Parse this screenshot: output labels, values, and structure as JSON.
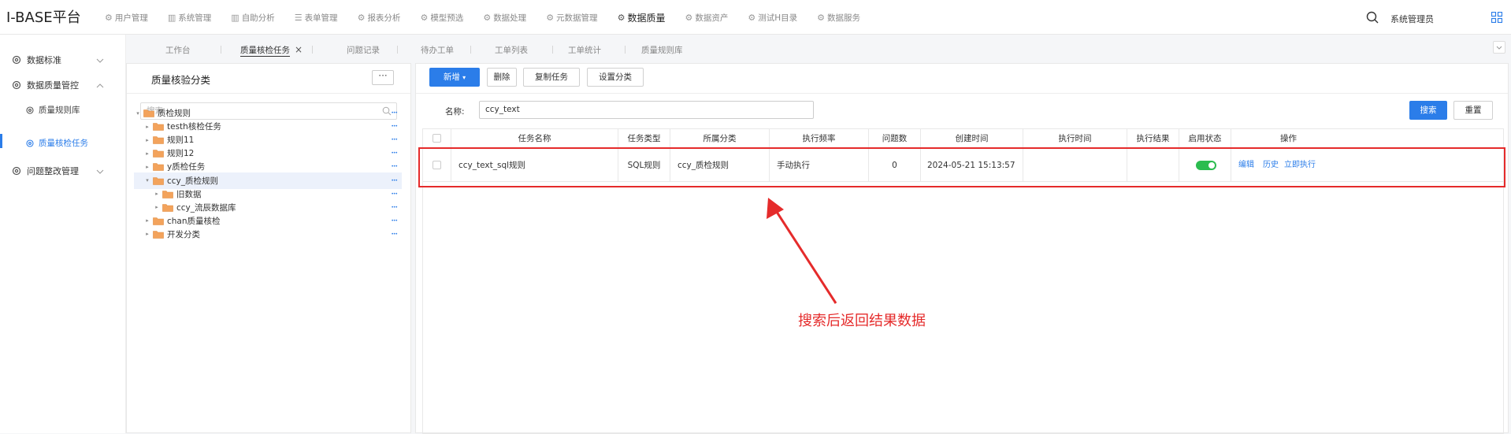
{
  "app": {
    "title": "I-BASE平台"
  },
  "topnav": [
    {
      "label": "用户管理",
      "icon": "gear-icon"
    },
    {
      "label": "系统管理",
      "icon": "bar-chart-icon"
    },
    {
      "label": "自助分析",
      "icon": "bar-chart-icon"
    },
    {
      "label": "表单管理",
      "icon": "list-icon"
    },
    {
      "label": "报表分析",
      "icon": "gear-icon"
    },
    {
      "label": "模型预选",
      "icon": "gear-icon"
    },
    {
      "label": "数据处理",
      "icon": "gear-icon"
    },
    {
      "label": "元数据管理",
      "icon": "gear-icon"
    },
    {
      "label": "数据质量",
      "icon": "gear-icon",
      "active": true
    },
    {
      "label": "数据资产",
      "icon": "gear-icon"
    },
    {
      "label": "测试H目录",
      "icon": "gear-icon"
    },
    {
      "label": "数据服务",
      "icon": "gear-icon"
    }
  ],
  "user": {
    "name": "系统管理员"
  },
  "sidebar": {
    "groups": [
      {
        "label": "数据标准"
      },
      {
        "label": "数据质量管控"
      },
      {
        "label": "问题整改管理"
      }
    ],
    "subitems": [
      {
        "label": "质量规则库"
      },
      {
        "label": "质量核检任务"
      }
    ]
  },
  "tabs": [
    {
      "label": "工作台"
    },
    {
      "label": "质量核检任务",
      "active": true
    },
    {
      "label": "问题记录"
    },
    {
      "label": "待办工单"
    },
    {
      "label": "工单列表"
    },
    {
      "label": "工单统计"
    },
    {
      "label": "质量规则库"
    }
  ],
  "tree": {
    "title": "质量核验分类",
    "more": "···",
    "search_placeholder": "搜索",
    "nodes": [
      {
        "label": "质检规则",
        "level": 0,
        "arrow": "▾"
      },
      {
        "label": "testh核检任务",
        "level": 1,
        "arrow": "▸"
      },
      {
        "label": "规则11",
        "level": 1,
        "arrow": "▸"
      },
      {
        "label": "规则12",
        "level": 1,
        "arrow": "▸"
      },
      {
        "label": "y质检任务",
        "level": 1,
        "arrow": "▸"
      },
      {
        "label": "ccy_质检规则",
        "level": 1,
        "arrow": "▾",
        "selected": true
      },
      {
        "label": "旧数据",
        "level": 2,
        "arrow": "▸"
      },
      {
        "label": "ccy_流辰数据库",
        "level": 2,
        "arrow": "▸"
      },
      {
        "label": "chan质量核检",
        "level": 1,
        "arrow": "▸"
      },
      {
        "label": "开发分类",
        "level": 1,
        "arrow": "▸"
      }
    ]
  },
  "toolbar": {
    "add": "新增",
    "delete": "删除",
    "copy": "复制任务",
    "set_category": "设置分类",
    "search": "搜索",
    "reset": "重置"
  },
  "filter": {
    "name_label": "名称:",
    "name_value": "ccy_text"
  },
  "table": {
    "columns": [
      "任务名称",
      "任务类型",
      "所属分类",
      "执行频率",
      "问题数",
      "创建时间",
      "执行时间",
      "执行结果",
      "启用状态",
      "操作"
    ],
    "rows": [
      {
        "name": "ccy_text_sql规则",
        "type": "SQL规则",
        "category": "ccy_质检规则",
        "frequency": "手动执行",
        "issues": "0",
        "created": "2024-05-21 15:13:57",
        "exec_time": "",
        "result": "",
        "enabled": true,
        "actions": [
          "编辑",
          "历史",
          "立即执行"
        ]
      }
    ]
  },
  "annotation": {
    "text": "搜索后返回结果数据",
    "color": "#e52b2b"
  },
  "colors": {
    "accent": "#2b7de9",
    "toggle_on": "#2bbc4f"
  }
}
